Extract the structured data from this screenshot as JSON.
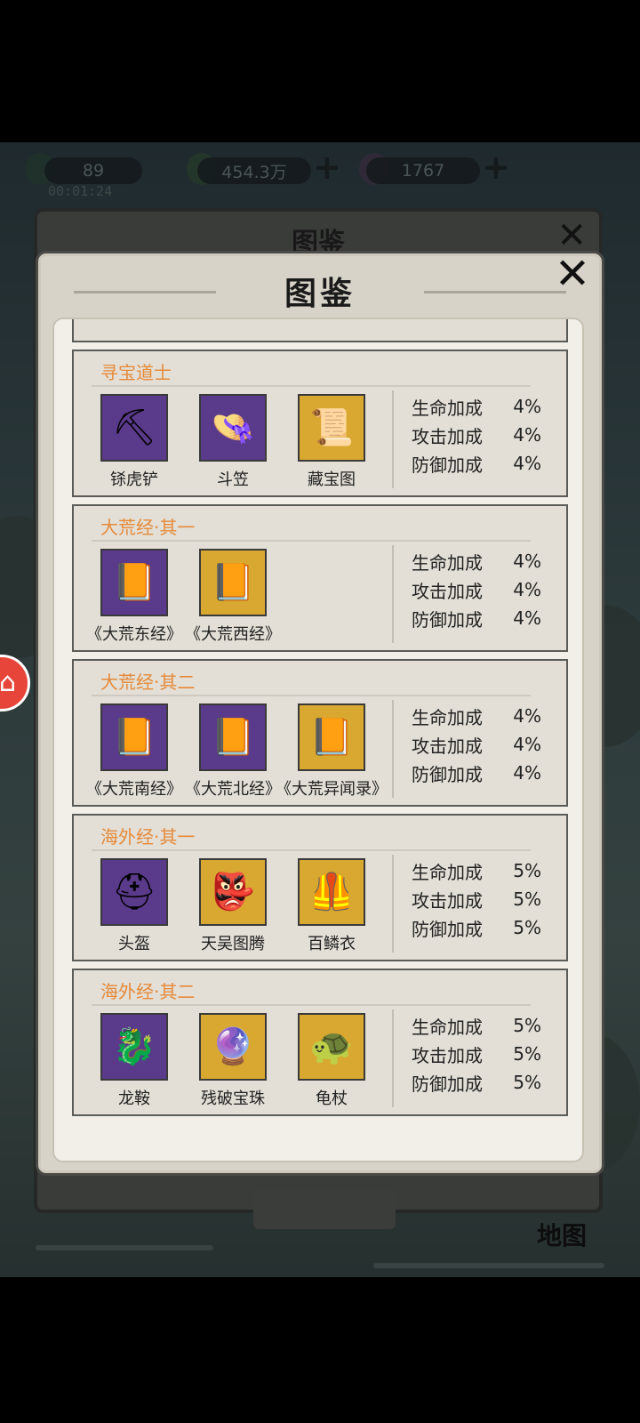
{
  "resources": {
    "stamina": "89",
    "currency": "454.3万",
    "gems": "1767",
    "timer": "00:01:24",
    "plus": "+"
  },
  "back_dialog": {
    "title": "图鉴",
    "close": "✕",
    "map_label": "地图"
  },
  "dialog": {
    "title": "图鉴",
    "close": "✕"
  },
  "sections": [
    {
      "title": "寻宝道士",
      "items": [
        {
          "name": "铩虎铲",
          "rarity": "purple",
          "icon": "pickaxe-icon",
          "glyph": "⛏"
        },
        {
          "name": "斗笠",
          "rarity": "purple",
          "icon": "straw-hat-icon",
          "glyph": "👒"
        },
        {
          "name": "藏宝图",
          "rarity": "gold",
          "icon": "treasure-map-icon",
          "glyph": "📜"
        }
      ],
      "stats": [
        {
          "label": "生命加成",
          "value": "4%"
        },
        {
          "label": "攻击加成",
          "value": "4%"
        },
        {
          "label": "防御加成",
          "value": "4%"
        }
      ]
    },
    {
      "title": "大荒经·其一",
      "items": [
        {
          "name": "《大荒东经》",
          "rarity": "purple",
          "icon": "book-icon",
          "glyph": "📙"
        },
        {
          "name": "《大荒西经》",
          "rarity": "gold",
          "icon": "book-icon",
          "glyph": "📙"
        }
      ],
      "stats": [
        {
          "label": "生命加成",
          "value": "4%"
        },
        {
          "label": "攻击加成",
          "value": "4%"
        },
        {
          "label": "防御加成",
          "value": "4%"
        }
      ]
    },
    {
      "title": "大荒经·其二",
      "items": [
        {
          "name": "《大荒南经》",
          "rarity": "purple",
          "icon": "book-icon",
          "glyph": "📙"
        },
        {
          "name": "《大荒北经》",
          "rarity": "purple",
          "icon": "book-icon",
          "glyph": "📙"
        },
        {
          "name": "《大荒异闻录》",
          "rarity": "gold",
          "icon": "book-icon",
          "glyph": "📙"
        }
      ],
      "stats": [
        {
          "label": "生命加成",
          "value": "4%"
        },
        {
          "label": "攻击加成",
          "value": "4%"
        },
        {
          "label": "防御加成",
          "value": "4%"
        }
      ]
    },
    {
      "title": "海外经·其一",
      "items": [
        {
          "name": "头盔",
          "rarity": "purple",
          "icon": "helmet-icon",
          "glyph": "⛑"
        },
        {
          "name": "天吴图腾",
          "rarity": "gold",
          "icon": "mask-icon",
          "glyph": "👺"
        },
        {
          "name": "百鳞衣",
          "rarity": "gold",
          "icon": "armor-icon",
          "glyph": "🦺"
        }
      ],
      "stats": [
        {
          "label": "生命加成",
          "value": "5%"
        },
        {
          "label": "攻击加成",
          "value": "5%"
        },
        {
          "label": "防御加成",
          "value": "5%"
        }
      ]
    },
    {
      "title": "海外经·其二",
      "items": [
        {
          "name": "龙鞍",
          "rarity": "purple",
          "icon": "saddle-icon",
          "glyph": "🐉"
        },
        {
          "name": "残破宝珠",
          "rarity": "gold",
          "icon": "orb-icon",
          "glyph": "🔮"
        },
        {
          "name": "龟杖",
          "rarity": "gold",
          "icon": "turtle-staff-icon",
          "glyph": "🐢"
        }
      ],
      "stats": [
        {
          "label": "生命加成",
          "value": "5%"
        },
        {
          "label": "攻击加成",
          "value": "5%"
        },
        {
          "label": "防御加成",
          "value": "5%"
        }
      ]
    }
  ]
}
